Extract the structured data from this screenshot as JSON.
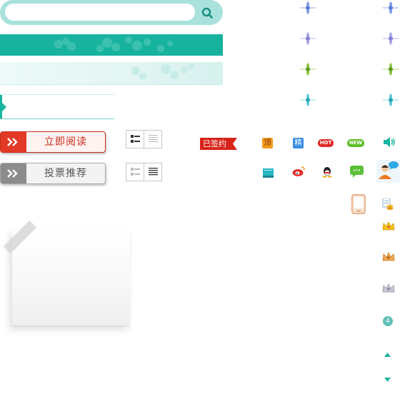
{
  "search": {
    "placeholder": "",
    "value": ""
  },
  "buttons": {
    "read_now": "立即阅读",
    "vote_recommend": "投票推荐"
  },
  "tags": {
    "signed": "已签约",
    "hot": "HOT",
    "new": "NEW",
    "top": "顶",
    "fine": "精"
  },
  "badge": {
    "number": "4"
  },
  "colors": {
    "teal": "#18b39f",
    "teal_light": "#a9e1dc",
    "red": "#e23a26",
    "gray": "#8c8c8c"
  }
}
